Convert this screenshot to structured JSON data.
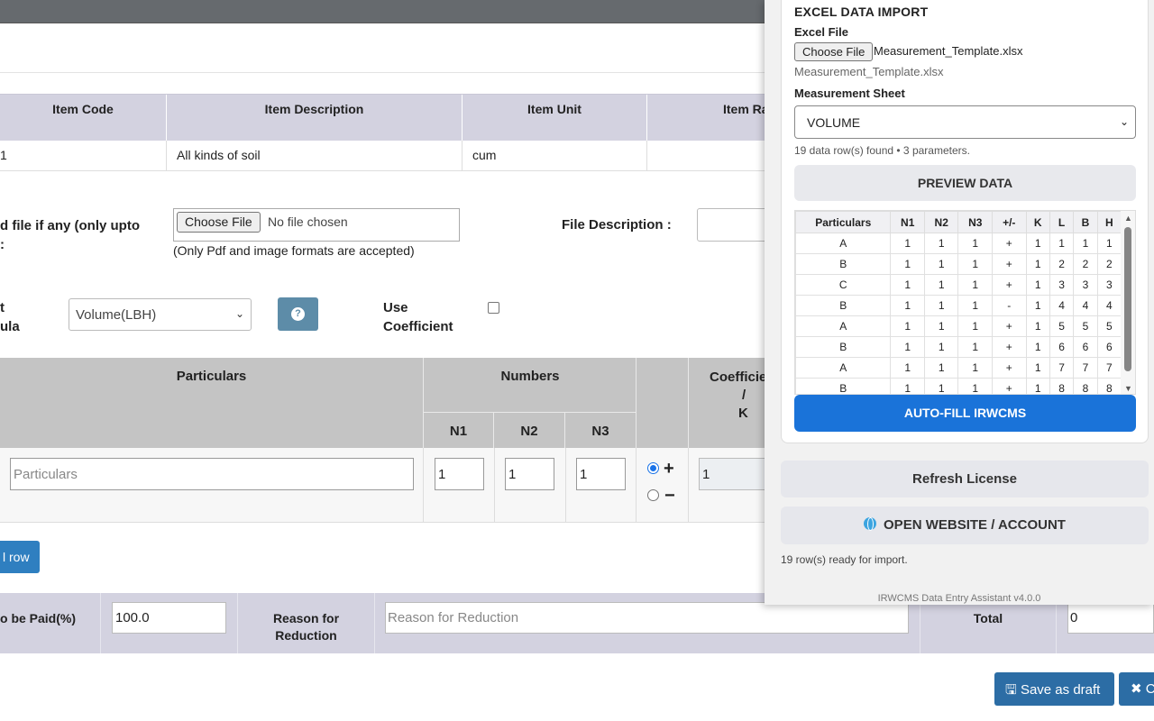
{
  "item_table": {
    "headers": [
      "Item Code",
      "Item Description",
      "Item Unit",
      "Item Ra"
    ],
    "row": [
      "1",
      "All kinds of soil",
      "cum",
      ""
    ]
  },
  "upload": {
    "label_line1": "d file if any (only upto",
    "label_line2": ":",
    "choose_label": "Choose File",
    "file_status": "No file chosen",
    "note": "(Only Pdf and image formats are accepted)",
    "desc_label": "File Description :"
  },
  "formula": {
    "label_line1": "t",
    "label_line2": "ula",
    "selected": "Volume(LBH)",
    "coef_line1": "Use",
    "coef_line2": "Coefficient"
  },
  "measure": {
    "particulars_header": "Particulars",
    "numbers_header": "Numbers",
    "n_headers": [
      "N1",
      "N2",
      "N3"
    ],
    "coef_header_line1": "Coefficie",
    "coef_header_line2": "/",
    "coef_header_line3": "K",
    "particulars_placeholder": "Particulars",
    "n_values": [
      "1",
      "1",
      "1"
    ],
    "coef_value": "1",
    "plus": "+",
    "minus": "−",
    "add_row": "l row"
  },
  "payment": {
    "paid_label": "o be Paid(%)",
    "paid_value": "100.0",
    "reason_label_line1": "Reason for",
    "reason_label_line2": "Reduction",
    "reason_placeholder": "Reason for Reduction",
    "total_label": "Total",
    "total_value": "0"
  },
  "actions": {
    "save_draft": "🖫 Save as draft",
    "close": "✖ C"
  },
  "panel": {
    "title": "EXCEL DATA IMPORT",
    "excel_file_label": "Excel File",
    "choose_label": "Choose File",
    "file_name": "Measurement_Template.xlsx",
    "file_name_sub": "Measurement_Template.xlsx",
    "sheet_label": "Measurement Sheet",
    "sheet_selected": "VOLUME",
    "info": "19 data row(s) found • 3 parameters.",
    "preview_button": "PREVIEW DATA",
    "table_headers": [
      "Particulars",
      "N1",
      "N2",
      "N3",
      "+/-",
      "K",
      "L",
      "B",
      "H"
    ],
    "table_rows": [
      [
        "A",
        "1",
        "1",
        "1",
        "+",
        "1",
        "1",
        "1",
        "1"
      ],
      [
        "B",
        "1",
        "1",
        "1",
        "+",
        "1",
        "2",
        "2",
        "2"
      ],
      [
        "C",
        "1",
        "1",
        "1",
        "+",
        "1",
        "3",
        "3",
        "3"
      ],
      [
        "B",
        "1",
        "1",
        "1",
        "-",
        "1",
        "4",
        "4",
        "4"
      ],
      [
        "A",
        "1",
        "1",
        "1",
        "+",
        "1",
        "5",
        "5",
        "5"
      ],
      [
        "B",
        "1",
        "1",
        "1",
        "+",
        "1",
        "6",
        "6",
        "6"
      ],
      [
        "A",
        "1",
        "1",
        "1",
        "+",
        "1",
        "7",
        "7",
        "7"
      ],
      [
        "B",
        "1",
        "1",
        "1",
        "+",
        "1",
        "8",
        "8",
        "8"
      ]
    ],
    "autofill_button": "AUTO-FILL IRWCMS",
    "refresh_button": "Refresh License",
    "website_button": "OPEN WEBSITE / ACCOUNT",
    "ready_status": "19 row(s) ready for import.",
    "version": "IRWCMS Data Entry Assistant v4.0.0"
  },
  "colors": {
    "header_bg": "#d3d2e0",
    "table_header_bg": "#c4c4c4",
    "primary_blue": "#1a73d9",
    "button_blue": "#2c6da5",
    "help_button": "#5d8ca8"
  }
}
